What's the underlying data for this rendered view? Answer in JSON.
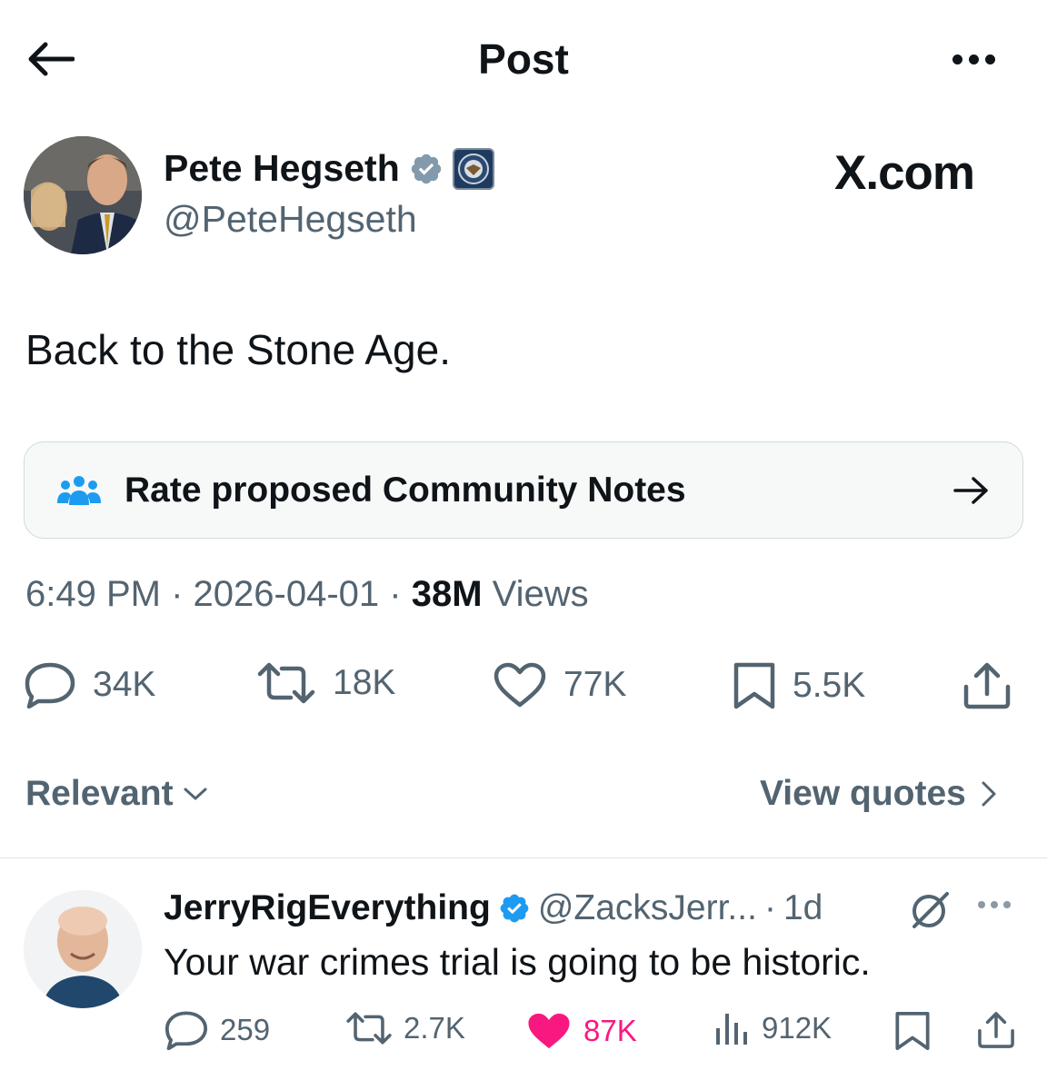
{
  "header": {
    "title": "Post"
  },
  "post": {
    "author_name": "Pete Hegseth",
    "author_handle": "@PeteHegseth",
    "watermark": "X.com",
    "text": "Back to the Stone Age.",
    "community_notes_label": "Rate proposed Community Notes",
    "time": "6:49 PM",
    "date": "2026-04-01",
    "views_count": "38M",
    "views_label": "Views",
    "separator": "·",
    "actions": {
      "replies": "34K",
      "reposts": "18K",
      "likes": "77K",
      "bookmarks": "5.5K"
    }
  },
  "replies_bar": {
    "sort_label": "Relevant",
    "view_quotes_label": "View quotes"
  },
  "reply": {
    "author_name": "JerryRigEverything",
    "author_handle": "@ZacksJerr...",
    "separator": "·",
    "age": "1d",
    "text": "Your war crimes trial is going to be historic.",
    "actions": {
      "replies": "259",
      "reposts": "2.7K",
      "likes": "87K",
      "views": "912K"
    }
  },
  "colors": {
    "text_primary": "#0f1419",
    "text_secondary": "#536471",
    "verified_blue": "#1d9bf0",
    "verified_gray": "#829aab",
    "like_pink": "#f91880",
    "notes_blue": "#1d9bf0"
  },
  "icons": [
    "back-arrow-icon",
    "more-icon",
    "verified-badge-icon",
    "affiliation-badge-icon",
    "community-notes-icon",
    "arrow-right-icon",
    "reply-icon",
    "repost-icon",
    "like-icon",
    "bookmark-icon",
    "share-icon",
    "chevron-down-icon",
    "chevron-right-icon",
    "grok-icon",
    "views-icon"
  ]
}
